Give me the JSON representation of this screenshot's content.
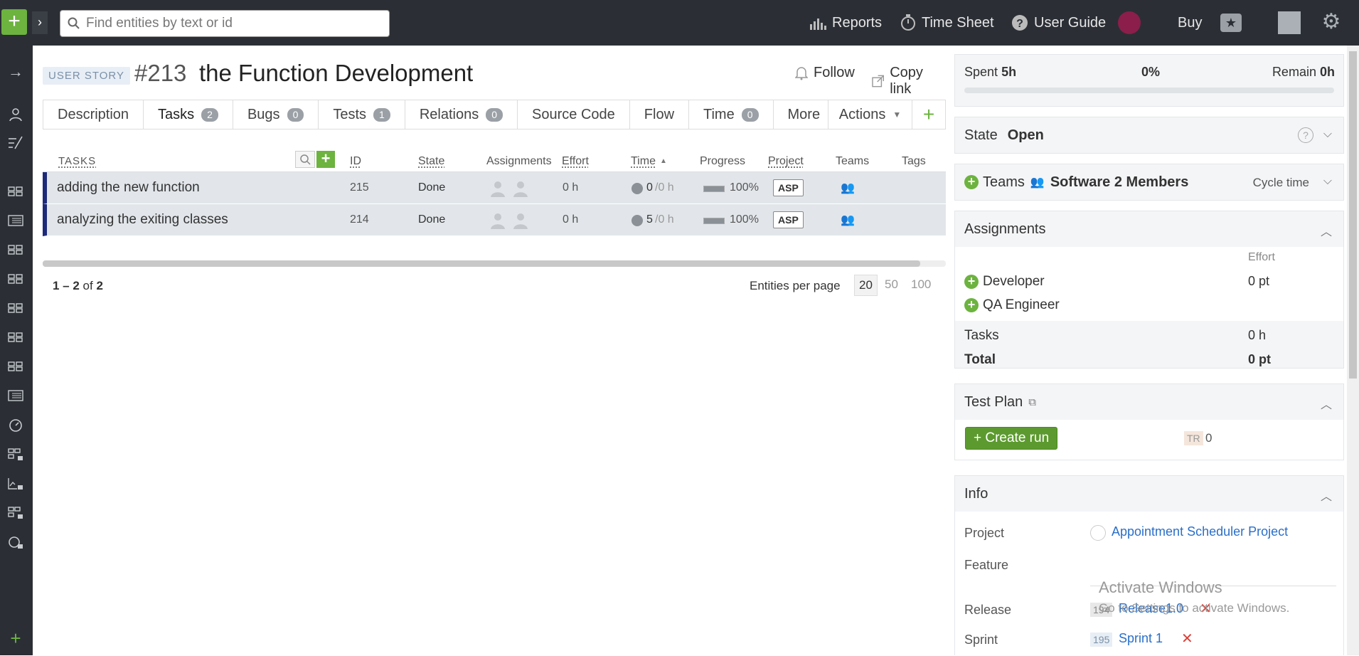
{
  "topbar": {
    "search_placeholder": "Find entities by text or id",
    "reports": "Reports",
    "timesheet": "Time Sheet",
    "userguide": "User Guide",
    "buy": "Buy"
  },
  "header": {
    "type_badge": "USER STORY",
    "id": "#213",
    "name": "the Function Development",
    "follow": "Follow",
    "copy_link": "Copy link"
  },
  "tabs": [
    {
      "label": "Description",
      "count": null
    },
    {
      "label": "Tasks",
      "count": "2"
    },
    {
      "label": "Bugs",
      "count": "0"
    },
    {
      "label": "Tests",
      "count": "1"
    },
    {
      "label": "Relations",
      "count": "0"
    },
    {
      "label": "Source Code",
      "count": null
    },
    {
      "label": "Flow",
      "count": null
    },
    {
      "label": "Time",
      "count": "0"
    },
    {
      "label": "More",
      "count": null
    }
  ],
  "actions_label": "Actions",
  "table": {
    "columns": [
      "TASKS",
      "ID",
      "State",
      "Assignments",
      "Effort",
      "Time",
      "Progress",
      "Project",
      "Teams",
      "Tags"
    ],
    "rows": [
      {
        "name": "adding the new function",
        "id": "215",
        "state": "Done",
        "effort": "0 h",
        "time_spent": "0",
        "time_rest": "/0 h",
        "progress": "100%",
        "project": "ASP"
      },
      {
        "name": "analyzing the exiting classes",
        "id": "214",
        "state": "Done",
        "effort": "0 h",
        "time_spent": "5",
        "time_rest": "/0 h",
        "progress": "100%",
        "project": "ASP"
      }
    ]
  },
  "pager": {
    "range": "1 – 2",
    "of": "of",
    "total": "2",
    "per_page_label": "Entities per page",
    "options": [
      "20",
      "50",
      "100"
    ]
  },
  "right": {
    "spent_label": "Spent",
    "spent_value": "5h",
    "percent": "0%",
    "remain_label": "Remain",
    "remain_value": "0h",
    "state_label": "State",
    "state_value": "Open",
    "teams_label": "Teams",
    "team_name": "Software 2 Members",
    "cycle_time": "Cycle time",
    "assignments_title": "Assignments",
    "effort_header": "Effort",
    "roles": [
      {
        "name": "Developer",
        "effort": "0 pt"
      },
      {
        "name": "QA Engineer",
        "effort": ""
      }
    ],
    "tasks_label": "Tasks",
    "tasks_value": "0 h",
    "total_label": "Total",
    "total_value": "0 pt",
    "testplan_title": "Test Plan",
    "create_run": "Create run",
    "tr_label": "TR",
    "tr_value": "0",
    "info_title": "Info",
    "project_label": "Project",
    "project_value": "Appointment Scheduler Project",
    "feature_label": "Feature",
    "release_label": "Release",
    "release_id": "194",
    "release_value": "Release1.0",
    "sprint_label": "Sprint",
    "sprint_id": "195",
    "sprint_value": "Sprint 1"
  },
  "watermark": {
    "line1": "Activate Windows",
    "line2": "Go to Settings to activate Windows."
  },
  "colors": {
    "accent_green": "#6cb33f",
    "topbar": "#2b2f35",
    "link": "#2a6fc8",
    "row_bar": "#1d2a7a"
  }
}
